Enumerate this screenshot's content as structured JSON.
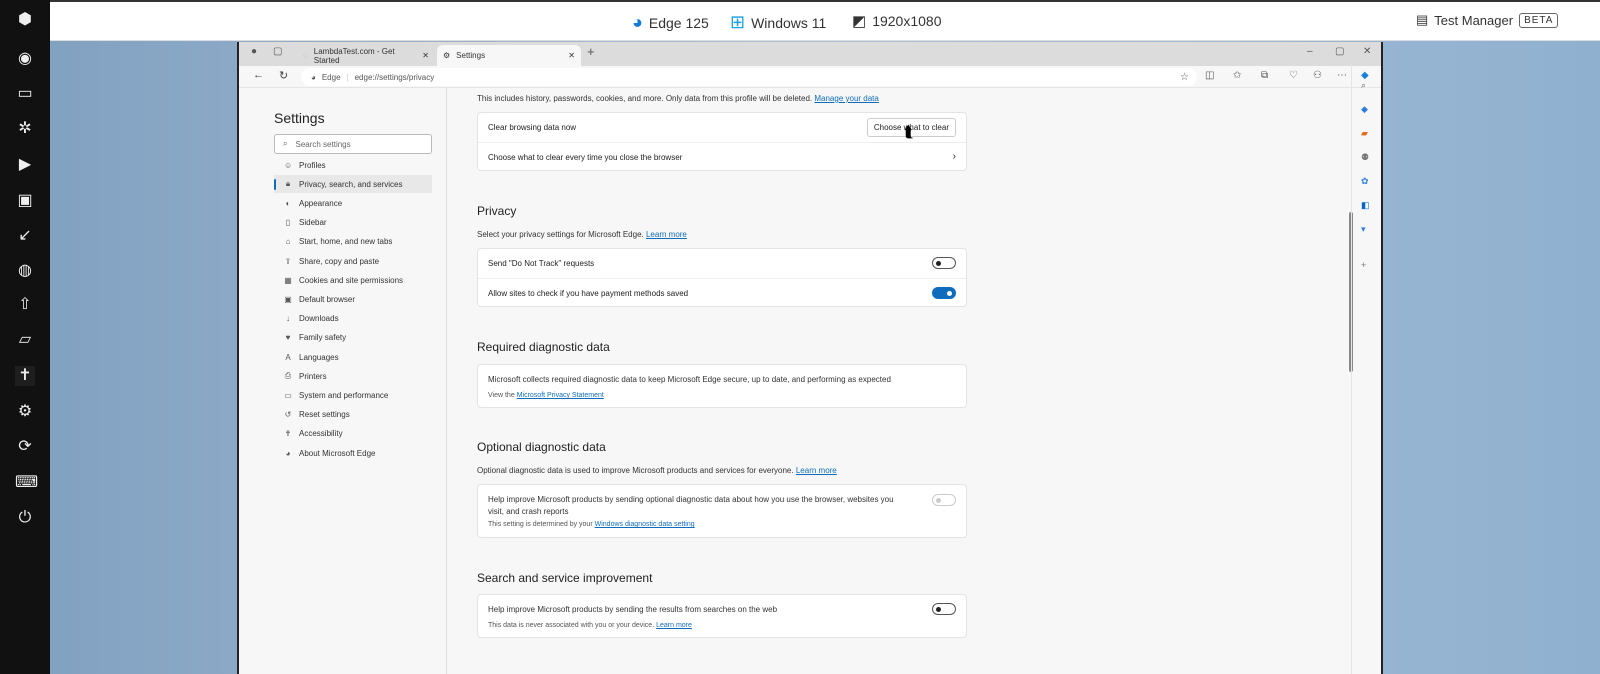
{
  "topbar": {
    "browser": "Edge 125",
    "os": "Windows 11",
    "resolution": "1920x1080",
    "test_manager": "Test Manager",
    "beta": "BETA"
  },
  "browser": {
    "tabs": [
      {
        "title": "LambdaTest.com - Get Started"
      },
      {
        "title": "Settings"
      }
    ],
    "address": {
      "site_label": "Edge",
      "url": "edge://settings/privacy"
    }
  },
  "settings": {
    "title": "Settings",
    "search_placeholder": "Search settings",
    "nav": [
      {
        "label": "Profiles",
        "icon": "profile-icon"
      },
      {
        "label": "Privacy, search, and services",
        "icon": "lock-icon",
        "selected": true
      },
      {
        "label": "Appearance",
        "icon": "appearance-icon"
      },
      {
        "label": "Sidebar",
        "icon": "sidebar-icon"
      },
      {
        "label": "Start, home, and new tabs",
        "icon": "home-icon"
      },
      {
        "label": "Share, copy and paste",
        "icon": "share-icon"
      },
      {
        "label": "Cookies and site permissions",
        "icon": "cookie-icon"
      },
      {
        "label": "Default browser",
        "icon": "browser-icon"
      },
      {
        "label": "Downloads",
        "icon": "download-icon"
      },
      {
        "label": "Family safety",
        "icon": "family-icon"
      },
      {
        "label": "Languages",
        "icon": "language-icon"
      },
      {
        "label": "Printers",
        "icon": "printer-icon"
      },
      {
        "label": "System and performance",
        "icon": "system-icon"
      },
      {
        "label": "Reset settings",
        "icon": "reset-icon"
      },
      {
        "label": "Accessibility",
        "icon": "accessibility-icon"
      },
      {
        "label": "About Microsoft Edge",
        "icon": "edge-icon"
      }
    ],
    "clear": {
      "desc": "This includes history, passwords, cookies, and more. Only data from this profile will be deleted.",
      "manage_link": "Manage your data",
      "now_label": "Clear browsing data now",
      "now_button": "Choose what to clear",
      "every_time": "Choose what to clear every time you close the browser"
    },
    "privacy": {
      "heading": "Privacy",
      "desc": "Select your privacy settings for Microsoft Edge.",
      "learn_more": "Learn more",
      "dnt": "Send \"Do Not Track\" requests",
      "dnt_on": false,
      "payment": "Allow sites to check if you have payment methods saved",
      "payment_on": true
    },
    "required": {
      "heading": "Required diagnostic data",
      "text": "Microsoft collects required diagnostic data to keep Microsoft Edge secure, up to date, and performing as expected",
      "view_the": "View the",
      "statement_link": "Microsoft Privacy Statement"
    },
    "optional": {
      "heading": "Optional diagnostic data",
      "desc": "Optional diagnostic data is used to improve Microsoft products and services for everyone.",
      "learn_more": "Learn more",
      "text1": "Help improve Microsoft products by sending optional diagnostic data about how you use the browser, websites you",
      "text2": "visit, and crash reports",
      "note": "This setting is determined by your",
      "note_link": "Windows diagnostic data setting"
    },
    "search": {
      "heading": "Search and service improvement",
      "text": "Help improve Microsoft products by sending the results from searches on the web",
      "note": "This data is never associated with you or your device.",
      "learn_more": "Learn more"
    }
  }
}
